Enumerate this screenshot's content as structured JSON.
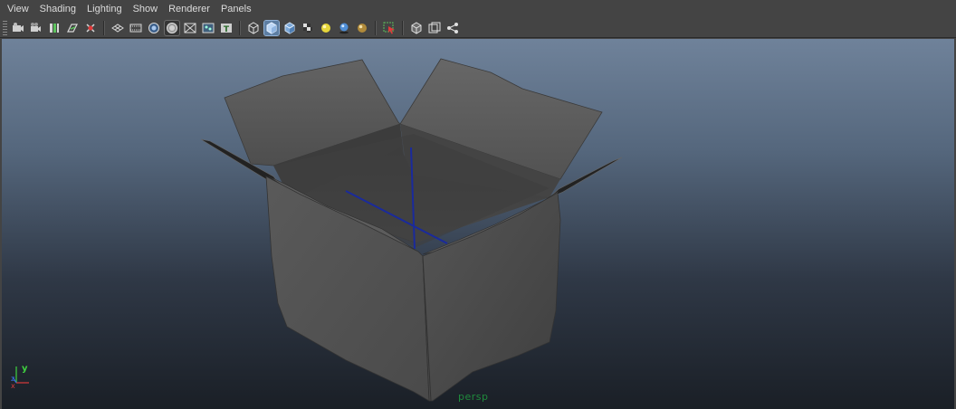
{
  "menu": {
    "items": [
      "View",
      "Shading",
      "Lighting",
      "Show",
      "Renderer",
      "Panels"
    ]
  },
  "toolbar": {
    "groups": [
      [
        "select-camera-icon",
        "camera-attributes-icon",
        "bookmarks-icon",
        "image-plane-icon",
        "two-d-pan-zoom-icon"
      ],
      [
        "grid-icon",
        "film-gate-icon",
        "resolution-gate-icon",
        "gate-mask-icon",
        "field-chart-icon",
        "safe-action-icon",
        "safe-title-icon"
      ],
      [
        "wireframe-icon",
        "smooth-shade-icon",
        "default-material-icon",
        "textured-icon",
        "use-default-light-icon",
        "shadows-icon",
        "high-quality-icon"
      ],
      [
        "isolate-select-icon",
        "xray-icon",
        "xray-joints-icon",
        "xray-components-icon"
      ]
    ],
    "active": "smooth-shade-icon"
  },
  "viewport": {
    "camera_label": "persp",
    "axis_labels": {
      "x": "x",
      "y": "y",
      "z": "z"
    },
    "colors": {
      "camera_label": "#1f8a3c",
      "axis_x": "#d83a3a",
      "axis_y": "#3fd23f",
      "axis_z": "#3a6ad8"
    }
  }
}
